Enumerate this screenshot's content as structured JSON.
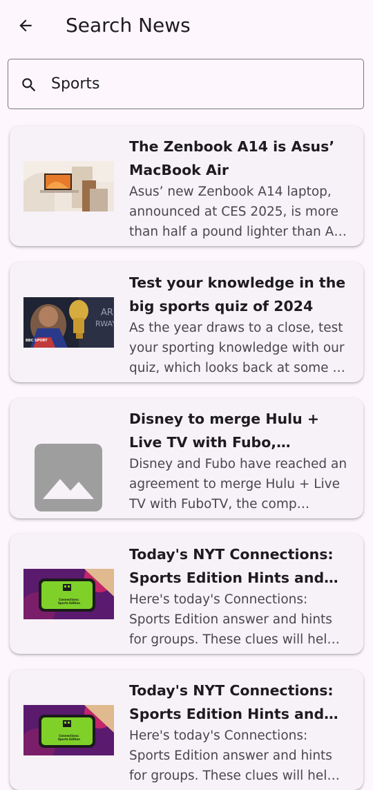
{
  "app_bar": {
    "title": "Search News",
    "back_icon": "arrow-back-icon"
  },
  "search": {
    "value": "Sports",
    "icon": "search-icon"
  },
  "articles": [
    {
      "title": "The Zenbook A14 is Asus’ MacBook Air",
      "description": "Asus’ new Zenbook A14 laptop, announced at CES 2025, is more than half a pound lighter than A…",
      "image": "laptop-on-desk-photo"
    },
    {
      "title": "Test your knowledge in the big sports quiz of 2024",
      "description": "As the year draws to a close, test your sporting knowledge with our quiz, which looks back at some …",
      "image": "athlete-with-trophy-photo",
      "image_caption": "BBC SPORT"
    },
    {
      "title": "Disney to merge Hulu + Live TV with Fubo, challenging …",
      "description": "Disney and Fubo have reached an agreement to merge Hulu + Live TV with FuboTV, the comp…",
      "image": "image-placeholder-icon"
    },
    {
      "title": "Today's NYT Connections: Sports Edition Hints and A…",
      "description": "Here's today's Connections: Sports Edition answer and hints for groups. These clues will hel…",
      "image": "phone-connections-game-photo",
      "image_caption": "Connections: Sports Edition"
    },
    {
      "title": "Today's NYT Connections: Sports Edition Hints and A…",
      "description": "Here's today's Connections: Sports Edition answer and hints for groups. These clues will hel…",
      "image": "phone-connections-game-photo",
      "image_caption": "Connections: Sports Edition"
    }
  ]
}
